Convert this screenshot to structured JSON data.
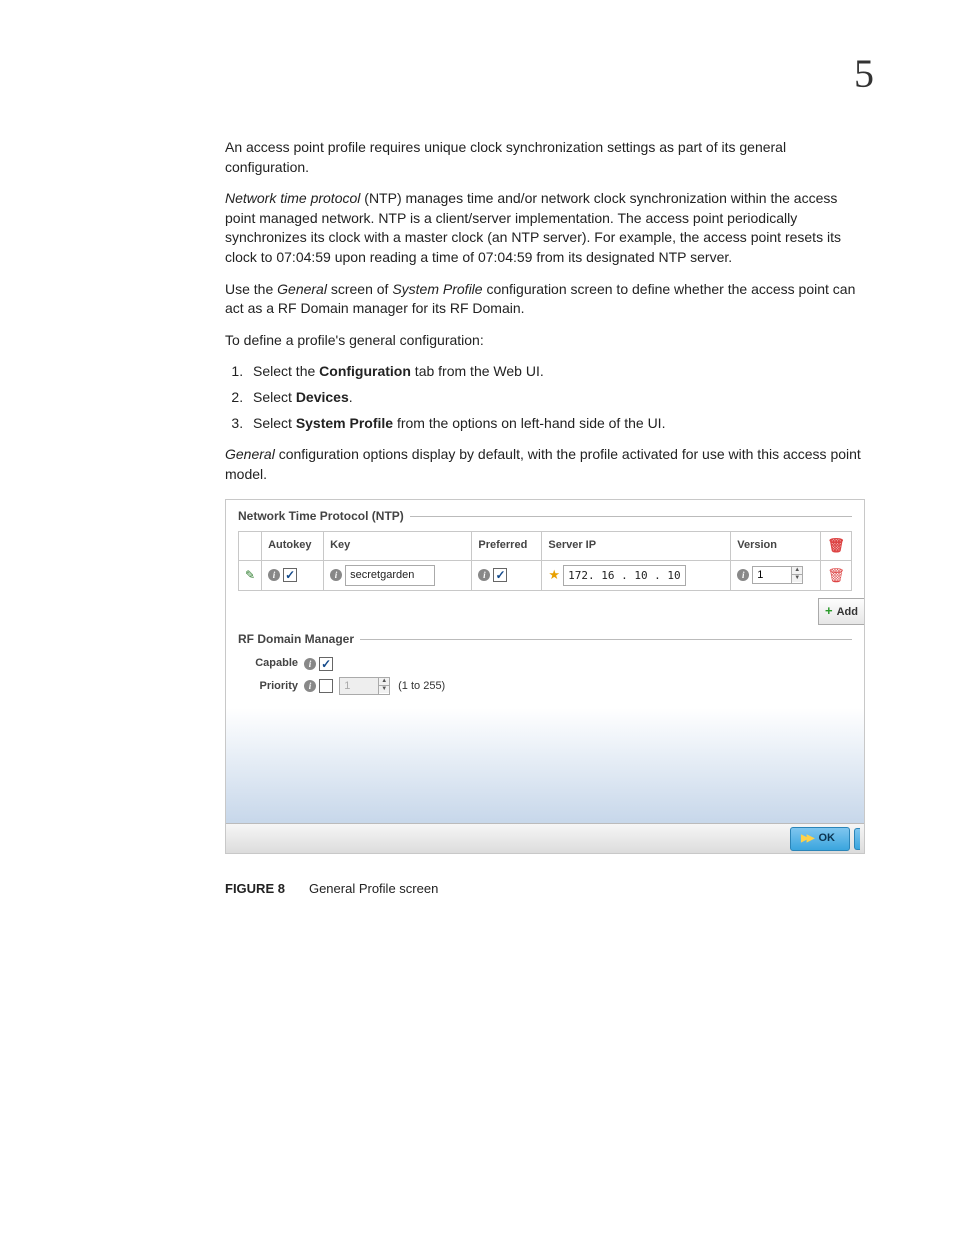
{
  "chapter_number": "5",
  "paragraphs": {
    "p1": "An access point profile requires unique clock synchronization settings as part of its general configuration.",
    "p2_lead": "Network time protocol",
    "p2_rest": " (NTP) manages time and/or network clock synchronization within the access point managed network. NTP is a client/server implementation. The access point periodically synchronizes its clock with a master clock (an NTP server). For example, the access point resets its clock to 07:04:59 upon reading a time of 07:04:59 from its designated NTP server.",
    "p3_a": "Use the ",
    "p3_b": "General",
    "p3_c": " screen of ",
    "p3_d": "System Profile",
    "p3_e": " configuration screen to define whether the access point can act as a RF Domain manager for its RF Domain.",
    "p4": "To define a profile's general configuration:",
    "step1_a": "Select the ",
    "step1_b": "Configuration",
    "step1_c": " tab from the Web UI.",
    "step2_a": "Select ",
    "step2_b": "Devices",
    "step2_c": ".",
    "step3_a": "Select ",
    "step3_b": "System Profile",
    "step3_c": " from the options on left-hand side of the UI.",
    "p5_a": "General",
    "p5_b": " configuration options display by default, with the profile activated for use with this access point model."
  },
  "screenshot": {
    "ntp_title": "Network Time Protocol (NTP)",
    "headers": {
      "autokey": "Autokey",
      "key": "Key",
      "preferred": "Preferred",
      "server_ip": "Server IP",
      "version": "Version"
    },
    "row": {
      "key_value": "secretgarden",
      "server_ip": "172. 16 . 10 . 10",
      "version_value": "1"
    },
    "add_label": "Add",
    "rfd_title": "RF Domain Manager",
    "capable_label": "Capable",
    "priority_label": "Priority",
    "priority_value": "1",
    "priority_range": "(1 to 255)",
    "ok_label": "OK"
  },
  "figure": {
    "label": "Figure 8",
    "caption": "General Profile screen"
  }
}
